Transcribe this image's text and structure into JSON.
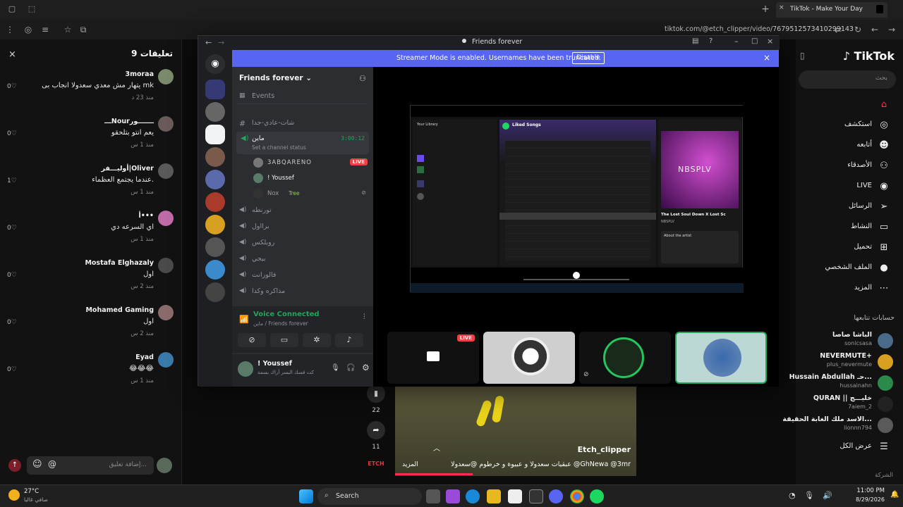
{
  "browser": {
    "tab_title": "TikTok - Make Your Day",
    "url": "tiktok.com/@etch_clipper/video/7679512573410299143",
    "new_tab": "+",
    "close_tab": "×"
  },
  "comments": {
    "header": "تعليقات 9",
    "close": "×",
    "items": [
      {
        "name": "3moraa",
        "text": "يتهار مش معدي سعدولا انجاب بى mk",
        "time": "منذ 23 د",
        "likes": "0"
      },
      {
        "name": "ـــNourـــــــور",
        "text": "يعم انتو بتلحقو",
        "time": "منذ 1 س",
        "likes": "0"
      },
      {
        "name": "أوليـــفر|Oliver",
        "text": "عندما يجتمع العظماء.",
        "time": "منذ 1 س",
        "likes": "1"
      },
      {
        "name": "أ•••",
        "text": "اي السرعه دي",
        "time": "منذ 1 س",
        "likes": "0"
      },
      {
        "name": "Mostafa Elghazaly",
        "text": "اول",
        "time": "منذ 2 س",
        "likes": "0"
      },
      {
        "name": "Mohamed Gaming",
        "text": "اول",
        "time": "منذ 2 س",
        "likes": "0"
      },
      {
        "name": "Eyad",
        "text": "😂😂😂",
        "time": "منذ 1 س",
        "likes": "0"
      }
    ],
    "reply_label": "رد",
    "input_placeholder": "إضافة تعليق...",
    "emoji_icon": "☺",
    "mention_icon": "@"
  },
  "discord": {
    "window_title": "Friends forever",
    "banner_text": "Streamer Mode is enabled. Usernames have been truncated.",
    "banner_button": "Disable",
    "server_name": "Friends forever",
    "events": "Events",
    "text_channel": "شات-عادي-جدا",
    "voice_channel": "ماين",
    "channel_status": "Set a channel status",
    "timer": "3:00:12",
    "members": [
      {
        "name": "3ABQARENO",
        "badge": "LIVE"
      },
      {
        "name": "! Youssef",
        "badge": ""
      },
      {
        "name": "Nox",
        "badge": "Tree"
      }
    ],
    "other_channels": [
      "تورنطه",
      "برااول",
      "روبلكس",
      "بيجي",
      "فالورانت",
      "مذاكره وكدا"
    ],
    "voice_connected": "Voice Connected",
    "voice_path": "ماين / Friends forever",
    "user_name": "! Youssef",
    "user_status": "كت قسك البسر أراك بسمة",
    "live_badge": "LIVE"
  },
  "spotify": {
    "library": "Your Library",
    "liked_songs": "Liked Songs",
    "now_playing": "The Lost Soul Down X Lost Sc",
    "artist": "NBSPLV",
    "cover_text": "NBSPLV",
    "about": "About the artist"
  },
  "video": {
    "username": "Etch_clipper",
    "caption": "عبقيات سعدولا و عبيوة و خرطوم @سعدولا @GhNewa @3mr",
    "more": "المزيد",
    "saves": "22",
    "shares": "11"
  },
  "tiktok_nav": {
    "logo": "TikTok",
    "search_placeholder": "بحث",
    "items": [
      {
        "label": "استكشف",
        "icon": "compass-icon"
      },
      {
        "label": "أتابعه",
        "icon": "following-icon"
      },
      {
        "label": "الأصدقاء",
        "icon": "friends-icon"
      },
      {
        "label": "LIVE",
        "icon": "live-icon"
      },
      {
        "label": "الرسائل",
        "icon": "messages-icon"
      },
      {
        "label": "النشاط",
        "icon": "activity-icon"
      },
      {
        "label": "تحميل",
        "icon": "upload-icon"
      },
      {
        "label": "الملف الشخصي",
        "icon": "profile-icon"
      },
      {
        "label": "المزيد",
        "icon": "more-icon"
      }
    ],
    "following_header": "حسابات تتابعها",
    "following": [
      {
        "name": "الباشا صاصا",
        "handle": "sonicsasa"
      },
      {
        "name": "NEVERMUTE+",
        "handle": "plus_nevermute"
      },
      {
        "name": "Hussain Abdullah حـ...",
        "handle": "hussainahn"
      },
      {
        "name": "QURAN || خليـــج",
        "handle": "7aiem_2"
      },
      {
        "name": "الاسد ملك الغابة الحقيقة...",
        "handle": "lionnn794"
      }
    ],
    "see_all": "عرض الكل",
    "company": "الشركة"
  },
  "taskbar": {
    "weather_temp": "27°C",
    "weather_desc": "صافي غالبا",
    "search": "Search",
    "time": "11:00 PM",
    "date": "8/29/2026"
  },
  "colors": {
    "discord_blurple": "#5865f2",
    "discord_green": "#23a559",
    "live_red": "#ed4245",
    "tiktok_red": "#fe2c55"
  }
}
